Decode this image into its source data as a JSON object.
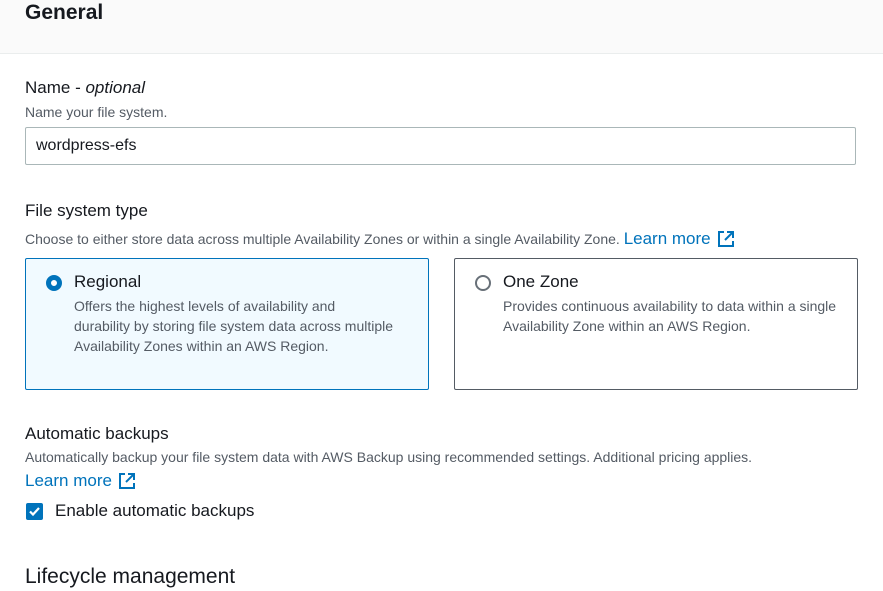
{
  "section": {
    "title": "General"
  },
  "name_field": {
    "label": "Name - ",
    "label_optional": "optional",
    "description": "Name your file system.",
    "value": "wordpress-efs"
  },
  "file_system_type": {
    "label": "File system type",
    "description": "Choose to either store data across multiple Availability Zones or within a single Availability Zone.",
    "learn_more": "Learn more",
    "options": [
      {
        "title": "Regional",
        "description": "Offers the highest levels of availability and durability by storing file system data across multiple Availability Zones within an AWS Region.",
        "selected": true
      },
      {
        "title": "One Zone",
        "description": "Provides continuous availability to data within a single Availability Zone within an AWS Region.",
        "selected": false
      }
    ]
  },
  "automatic_backups": {
    "label": "Automatic backups",
    "description": "Automatically backup your file system data with AWS Backup using recommended settings. Additional pricing applies.",
    "learn_more": "Learn more",
    "checkbox_label": "Enable automatic backups",
    "checked": true
  },
  "next_section": {
    "title": "Lifecycle management"
  },
  "colors": {
    "accent": "#0073bb",
    "selected_bg": "#f1faff",
    "text": "#16191f",
    "secondary_text": "#545b64"
  }
}
